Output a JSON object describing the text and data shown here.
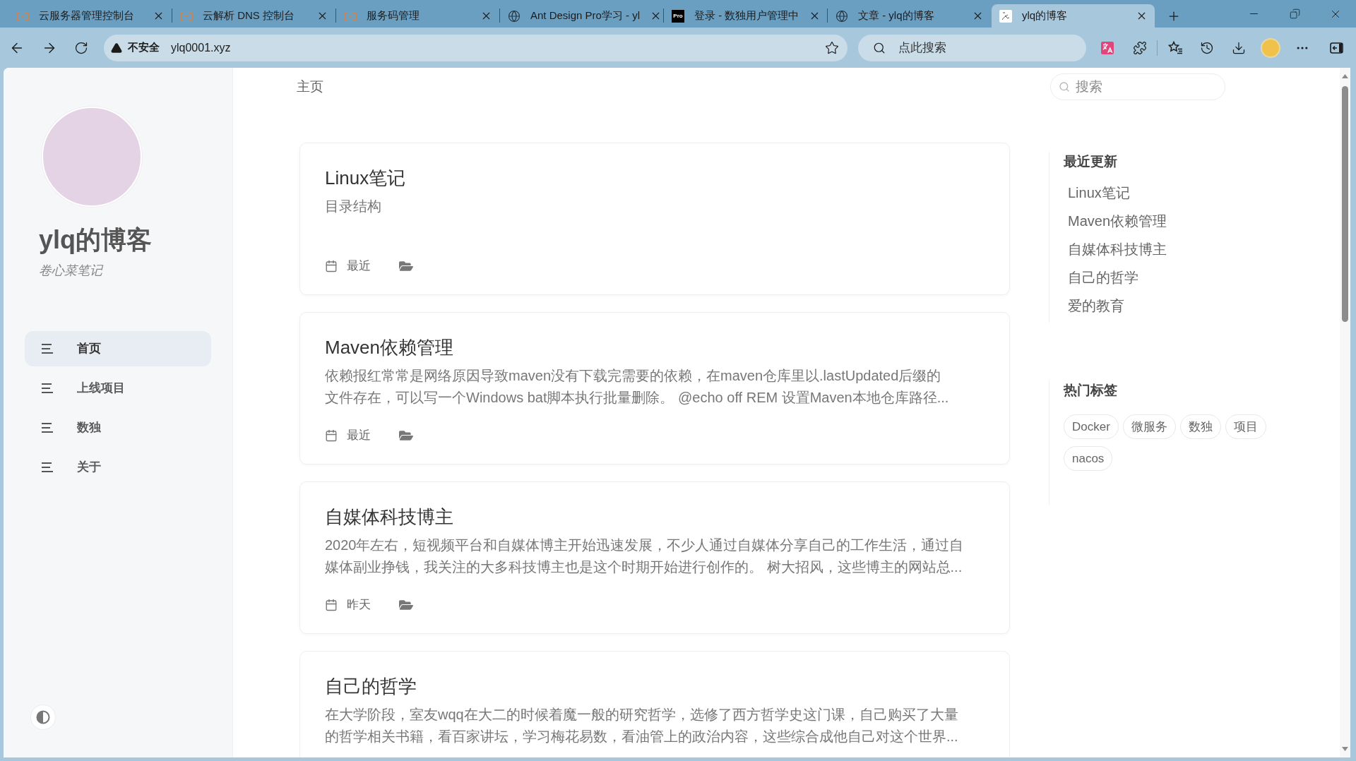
{
  "browser": {
    "tabs": [
      {
        "title": "云服务器管理控制台",
        "kind": "bracket",
        "selected": false
      },
      {
        "title": "云解析 DNS 控制台",
        "kind": "bracket",
        "selected": false
      },
      {
        "title": "服务码管理",
        "kind": "bracket",
        "selected": false
      },
      {
        "title": "Ant Design Pro学习 - yl",
        "kind": "globe",
        "selected": false
      },
      {
        "title": "登录 - 数独用户管理中",
        "kind": "badge",
        "favicon_text": "Pro",
        "selected": false
      },
      {
        "title": "文章 - ylq的博客",
        "kind": "globe",
        "selected": false
      },
      {
        "title": "ylq的博客",
        "kind": "image",
        "selected": true
      }
    ],
    "address_bar": {
      "security_label": "不安全",
      "url": "ylq0001.xyz"
    },
    "search": {
      "placeholder": "点此搜索"
    }
  },
  "sidebar": {
    "title": "ylq的博客",
    "subtitle": "卷心菜笔记",
    "nav": [
      {
        "label": "首页",
        "selected": true
      },
      {
        "label": "上线项目",
        "selected": false
      },
      {
        "label": "数独",
        "selected": false
      },
      {
        "label": "关于",
        "selected": false
      }
    ]
  },
  "main": {
    "breadcrumb": "主页",
    "posts": [
      {
        "title": "Linux笔记",
        "excerpt": [
          "目录结构"
        ],
        "date": "最近"
      },
      {
        "title": "Maven依赖管理",
        "excerpt": [
          "依赖报红常常是网络原因导致maven没有下载完需要的依赖，在maven仓库里以.lastUpdated后缀的",
          "文件存在，可以写一个Windows bat脚本执行批量删除。 @echo off REM 设置Maven本地仓库路径..."
        ],
        "date": "最近"
      },
      {
        "title": "自媒体科技博主",
        "excerpt": [
          "2020年左右，短视频平台和自媒体博主开始迅速发展，不少人通过自媒体分享自己的工作生活，通过自",
          "媒体副业挣钱，我关注的大多科技博主也是这个时期开始进行创作的。 树大招风，这些博主的网站总..."
        ],
        "date": "昨天"
      },
      {
        "title": "自己的哲学",
        "excerpt": [
          "在大学阶段，室友wqq在大二的时候着魔一般的研究哲学，选修了西方哲学史这门课，自己购买了大量",
          "的哲学相关书籍，看百家讲坛，学习梅花易数，看油管上的政治内容，这些综合成他自己对这个世界..."
        ]
      }
    ]
  },
  "aside": {
    "search": {
      "placeholder": "搜索"
    },
    "recent": {
      "heading": "最近更新",
      "items": [
        "Linux笔记",
        "Maven依赖管理",
        "自媒体科技博主",
        "自己的哲学",
        "爱的教育"
      ]
    },
    "tags": {
      "heading": "热门标签",
      "items": [
        "Docker",
        "微服务",
        "数独",
        "项目",
        "nacos"
      ]
    }
  }
}
